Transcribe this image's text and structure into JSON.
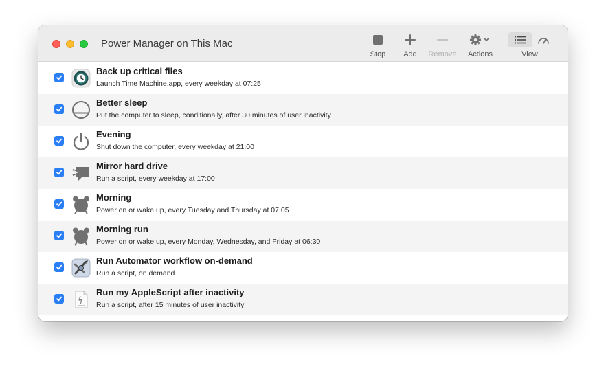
{
  "window": {
    "title": "Power Manager on This Mac"
  },
  "toolbar": {
    "stop_label": "Stop",
    "add_label": "Add",
    "remove_label": "Remove",
    "actions_label": "Actions",
    "view_label": "View"
  },
  "colors": {
    "accent": "#2a7ff6",
    "alt_row": "#f4f4f4",
    "icon_gray": "#707070"
  },
  "events": [
    {
      "title": "Back up critical files",
      "subtitle": "Launch Time Machine.app, every weekday at 07:25",
      "checked": true,
      "icon": "time-machine-icon"
    },
    {
      "title": "Better sleep",
      "subtitle": "Put the computer to sleep, conditionally, after 30 minutes of user inactivity",
      "checked": true,
      "icon": "sleep-icon"
    },
    {
      "title": "Evening",
      "subtitle": "Shut down the computer, every weekday at 21:00",
      "checked": true,
      "icon": "power-icon"
    },
    {
      "title": "Mirror hard drive",
      "subtitle": "Run a script, every weekday at 17:00",
      "checked": true,
      "icon": "script-icon"
    },
    {
      "title": "Morning",
      "subtitle": "Power on or wake up, every Tuesday and Thursday at 07:05",
      "checked": true,
      "icon": "alarm-clock-icon"
    },
    {
      "title": "Morning run",
      "subtitle": "Power on or wake up, every Monday, Wednesday, and Friday at 06:30",
      "checked": true,
      "icon": "alarm-clock-icon"
    },
    {
      "title": "Run Automator workflow on-demand",
      "subtitle": "Run a script, on demand",
      "checked": true,
      "icon": "automator-icon"
    },
    {
      "title": "Run my AppleScript after inactivity",
      "subtitle": "Run a script, after 15 minutes of user inactivity",
      "checked": true,
      "icon": "applescript-icon"
    }
  ]
}
